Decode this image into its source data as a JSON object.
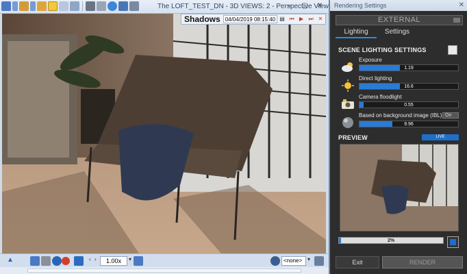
{
  "perspective_window": {
    "caption": "The LOFT_TEST_DN - 3D VIEWS: 2 - Perspective View",
    "win_buttons": [
      "–",
      "▢",
      "✕"
    ],
    "shadows": {
      "label": "Shadows",
      "datetime": "04/04/2019 08:15:40"
    },
    "bottom": {
      "zoom": "1.00x",
      "view_select": "<none>"
    }
  },
  "rendering_settings": {
    "title": "Rendering Settings",
    "close": "✕",
    "mode": "EXTERNAL",
    "tabs": [
      {
        "label": "Lighting"
      },
      {
        "label": "Settings"
      }
    ],
    "section_title": "SCENE LIGHTING SETTINGS",
    "sliders": [
      {
        "label": "Exposure",
        "value": "1.19",
        "fraction": 0.41
      },
      {
        "label": "Direct lighting",
        "value": "16.6",
        "fraction": 0.41
      },
      {
        "label": "Camera floodlight",
        "value": "0.55",
        "fraction": 0.04
      },
      {
        "label": "Based on background image (IBL)",
        "value": "9.96",
        "fraction": 0.33,
        "toggle": "On"
      }
    ],
    "preview_title": "PREVIEW",
    "live_label": "LIVE",
    "progress": {
      "value": "2%",
      "fraction": 0.02
    },
    "exit_label": "Exit",
    "render_label": "RENDER"
  },
  "colors": {
    "accent": "#2a7bd6",
    "panel_bg": "#2d2d2d",
    "shadow_icon_red": "#c0392b"
  }
}
